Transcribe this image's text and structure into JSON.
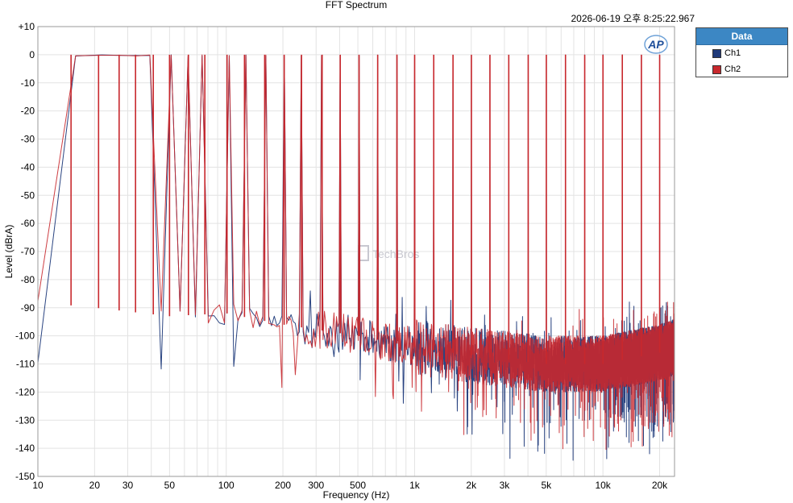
{
  "chart_data": {
    "type": "line",
    "title": "FFT Spectrum",
    "timestamp": "2026-06-19 오후 8:25:22.967",
    "xlabel": "Frequency (Hz)",
    "ylabel": "Level (dBrA)",
    "xscale": "log",
    "xlim": [
      10,
      24000
    ],
    "ylim": [
      -150,
      10
    ],
    "yticks": [
      10,
      0,
      -10,
      -20,
      -30,
      -40,
      -50,
      -60,
      -70,
      -80,
      -90,
      -100,
      -110,
      -120,
      -130,
      -140,
      -150
    ],
    "ytick_labels": [
      "+10",
      "0",
      "-10",
      "-20",
      "-30",
      "-40",
      "-50",
      "-60",
      "-70",
      "-80",
      "-90",
      "-100",
      "-110",
      "-120",
      "-130",
      "-140",
      "-150"
    ],
    "xticks": [
      10,
      20,
      30,
      50,
      100,
      200,
      300,
      500,
      1000,
      2000,
      3000,
      5000,
      10000,
      20000
    ],
    "xtick_labels": [
      "10",
      "20",
      "30",
      "50",
      "100",
      "200",
      "300",
      "500",
      "1k",
      "2k",
      "3k",
      "5k",
      "10k",
      "20k"
    ],
    "grid": true,
    "legend_position": "right-top",
    "tone_frequencies": [
      15,
      21,
      27,
      33,
      41,
      50,
      63,
      77,
      101,
      125,
      160,
      203,
      251,
      323,
      403,
      507,
      637,
      806,
      1001,
      1264,
      1600,
      2003,
      2513,
      3163,
      4013,
      5007,
      6329,
      8003,
      10007,
      12675,
      16007,
      20007
    ],
    "tone_peak_levels": [
      0,
      0,
      0,
      0,
      0,
      0,
      0,
      0,
      0,
      0,
      0,
      0,
      0,
      0,
      0,
      0,
      0,
      0,
      0,
      0,
      0,
      0,
      0,
      0,
      0,
      0,
      0,
      0,
      0,
      0,
      0,
      0
    ],
    "noise_floor_profile": {
      "frequency": [
        10,
        20,
        50,
        100,
        200,
        500,
        1000,
        2000,
        5000,
        10000,
        20000,
        24000
      ],
      "level": [
        -88,
        -90,
        -93,
        -92,
        -96,
        -100,
        -104,
        -107,
        -110,
        -110,
        -106,
        -104
      ]
    },
    "series": [
      {
        "name": "Ch1",
        "color": "#1f3a7a"
      },
      {
        "name": "Ch2",
        "color": "#c8282d"
      }
    ]
  },
  "watermark": "TechBros",
  "logo_text": "AP",
  "legend": {
    "header": "Data",
    "items": [
      "Ch1",
      "Ch2"
    ],
    "colors": [
      "#1f3a7a",
      "#c8282d"
    ]
  }
}
